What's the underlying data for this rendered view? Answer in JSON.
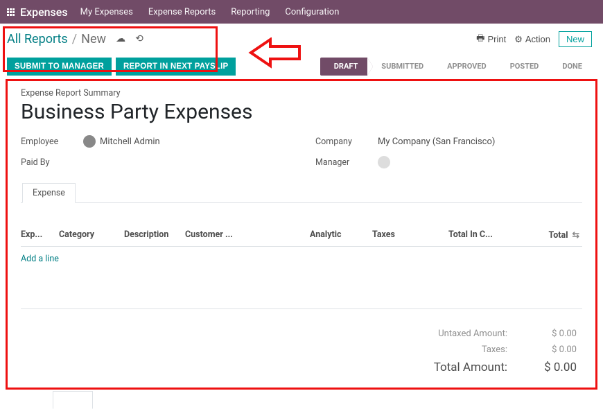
{
  "nav": {
    "brand": "Expenses",
    "items": [
      "My Expenses",
      "Expense Reports",
      "Reporting",
      "Configuration"
    ]
  },
  "breadcrumb": {
    "root": "All Reports",
    "current": "New"
  },
  "tools": {
    "print": "Print",
    "action": "Action",
    "new": "New"
  },
  "buttons": {
    "submit": "SUBMIT TO MANAGER",
    "payslip": "REPORT IN NEXT PAYSLIP"
  },
  "status": [
    "DRAFT",
    "SUBMITTED",
    "APPROVED",
    "POSTED",
    "DONE"
  ],
  "form": {
    "summary_label": "Expense Report Summary",
    "title": "Business Party Expenses",
    "employee_label": "Employee",
    "employee_value": "Mitchell Admin",
    "company_label": "Company",
    "company_value": "My Company (San Francisco)",
    "paidby_label": "Paid By",
    "manager_label": "Manager",
    "tab": "Expense",
    "cols": {
      "exp": "Exp...",
      "cat": "Category",
      "desc": "Description",
      "cust": "Customer ...",
      "anal": "Analytic",
      "tax": "Taxes",
      "tic": "Total In C...",
      "tot": "Total"
    },
    "add_line": "Add a line",
    "totals": {
      "untaxed_lbl": "Untaxed Amount:",
      "untaxed_val": "$ 0.00",
      "taxes_lbl": "Taxes:",
      "taxes_val": "$ 0.00",
      "total_lbl": "Total Amount:",
      "total_val": "$ 0.00"
    }
  }
}
